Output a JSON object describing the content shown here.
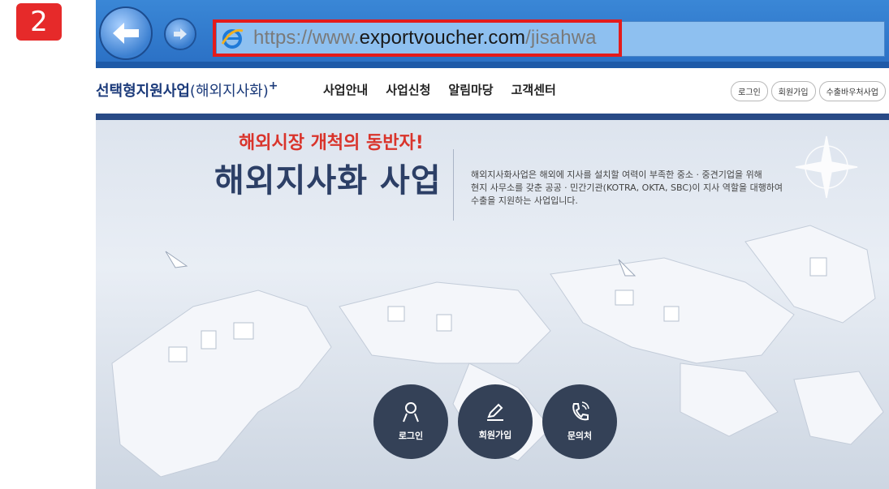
{
  "step_badge": "2",
  "browser": {
    "url_prefix": "https://www.",
    "url_domain": "exportvoucher.com",
    "url_path": "/jisahwa",
    "icons": [
      "back-arrow-icon",
      "forward-arrow-icon",
      "internet-explorer-icon"
    ],
    "highlight_color": "#e41b1b"
  },
  "site": {
    "logo_main": "선택형지원사업",
    "logo_paren": "(해외지사화)",
    "logo_plus": "+",
    "nav": [
      "사업안내",
      "사업신청",
      "알림마당",
      "고객센터"
    ],
    "util": [
      "로그인",
      "회원가입",
      "수출바우처사업"
    ],
    "accent": "#284a86"
  },
  "hero": {
    "subtitle": "해외시장 개척의 동반자!",
    "title": "해외지사화 사업",
    "desc_lines": [
      "해외지사화사업은 해외에 지사를 설치할 여력이 부족한 중소 · 중견기업을 위해",
      "현지 사무소를 갖춘 공공 · 민간기관(KOTRA, OKTA, SBC)이 지사 역할을 대행하여",
      "수출을 지원하는 사업입니다."
    ],
    "buttons": [
      {
        "label": "로그인",
        "icon": "user-icon"
      },
      {
        "label": "회원가입",
        "icon": "pencil-icon"
      },
      {
        "label": "문의처",
        "icon": "phone-icon"
      }
    ]
  }
}
